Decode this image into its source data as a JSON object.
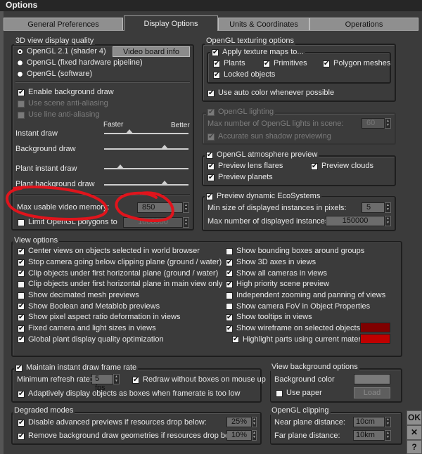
{
  "window": {
    "title": "Options"
  },
  "tabs": [
    {
      "label": "General Preferences",
      "active": false
    },
    {
      "label": "Display Options",
      "active": true
    },
    {
      "label": "Units & Coordinates",
      "active": false
    },
    {
      "label": "Operations",
      "active": false
    }
  ],
  "quality": {
    "legend": "3D view display quality",
    "renderers": [
      {
        "label": "OpenGL 2.1 (shader 4)",
        "selected": true
      },
      {
        "label": "OpenGL (fixed hardware pipeline)",
        "selected": false
      },
      {
        "label": "OpenGL (software)",
        "selected": false
      }
    ],
    "video_board_button": "Video board info",
    "enable_bg": {
      "label": "Enable background draw",
      "checked": true
    },
    "scene_aa": {
      "label": "Use scene anti-aliasing",
      "checked": false
    },
    "line_aa": {
      "label": "Use line anti-aliasing",
      "checked": false
    },
    "slider_left": "Faster",
    "slider_right": "Better",
    "sliders": [
      {
        "label": "Instant draw",
        "value": 0.3
      },
      {
        "label": "Background draw",
        "value": 0.72
      },
      {
        "label": "Plant instant draw",
        "value": 0.19
      },
      {
        "label": "Plant background draw",
        "value": 0.72
      }
    ],
    "max_mem_label": "Max usable video memory:",
    "max_mem_value": "850",
    "limit_poly": {
      "label": "Limit OpenGL polygons to",
      "checked": false
    },
    "limit_poly_value": "1000000"
  },
  "texturing": {
    "legend": "OpenGL texturing options",
    "apply": {
      "label": "Apply texture maps to...",
      "checked": true
    },
    "plants": {
      "label": "Plants",
      "checked": true
    },
    "primitives": {
      "label": "Primitives",
      "checked": true
    },
    "polygon": {
      "label": "Polygon meshes",
      "checked": true
    },
    "locked": {
      "label": "Locked objects",
      "checked": true
    },
    "auto_color": {
      "label": "Use auto color whenever possible",
      "checked": true
    }
  },
  "lighting": {
    "legend": {
      "label": "OpenGL lighting",
      "checked": true
    },
    "max_lights_label": "Max number of OpenGL lights in scene:",
    "max_lights_value": "60",
    "sun": {
      "label": "Accurate sun shadow previewing",
      "checked": true
    }
  },
  "atmosphere": {
    "legend": {
      "label": "OpenGL atmosphere preview",
      "checked": true
    },
    "lens": {
      "label": "Preview lens flares",
      "checked": true
    },
    "clouds": {
      "label": "Preview clouds",
      "checked": true
    },
    "planets": {
      "label": "Preview planets",
      "checked": true
    }
  },
  "eco": {
    "legend": {
      "label": "Preview dynamic EcoSystems",
      "checked": true
    },
    "min_size_label": "Min size of displayed instances in pixels:",
    "min_size_value": "5",
    "max_num_label": "Max number of displayed instances:",
    "max_num_value": "150000"
  },
  "view_options": {
    "legend": "View options",
    "left": [
      {
        "label": "Center views on objects selected in world browser",
        "checked": true
      },
      {
        "label": "Stop camera going below clipping plane (ground / water)",
        "checked": true
      },
      {
        "label": "Clip objects under first horizontal plane (ground / water)",
        "checked": true
      },
      {
        "label": "Clip objects under first horizontal plane in main view only",
        "checked": false
      },
      {
        "label": "Show decimated mesh previews",
        "checked": false
      },
      {
        "label": "Show Boolean and Metablob previews",
        "checked": true
      },
      {
        "label": "Show pixel aspect ratio deformation in views",
        "checked": true
      },
      {
        "label": "Fixed camera and light sizes in views",
        "checked": true
      },
      {
        "label": "Global plant display quality optimization",
        "checked": true
      }
    ],
    "right": [
      {
        "label": "Show bounding boxes around groups",
        "checked": false
      },
      {
        "label": "Show 3D axes in views",
        "checked": true
      },
      {
        "label": "Show all cameras in views",
        "checked": true
      },
      {
        "label": "High priority scene preview",
        "checked": true
      },
      {
        "label": "Independent zooming and panning of views",
        "checked": false
      },
      {
        "label": "Show camera FoV in Object Properties",
        "checked": false
      },
      {
        "label": "Show tooltips in views",
        "checked": true
      },
      {
        "label": "Show wireframe on selected objects",
        "checked": true
      },
      {
        "label": "Highlight parts using current material",
        "checked": true
      }
    ],
    "wireframe_color": "#800000",
    "highlight_color": "#c00000"
  },
  "framerate": {
    "legend": {
      "label": "Maintain instant draw frame rate",
      "checked": true
    },
    "min_refresh_label": "Minimum refresh rate:",
    "min_refresh_value": "5 fps",
    "redraw": {
      "label": "Redraw without boxes on mouse up",
      "checked": true
    },
    "adaptive": {
      "label": "Adaptively display objects as boxes when framerate is too low",
      "checked": true
    }
  },
  "background": {
    "legend": "View background options",
    "color_label": "Background color",
    "color": "#7a7a7a",
    "use_paper": {
      "label": "Use paper",
      "checked": false
    },
    "load_button": "Load"
  },
  "degraded": {
    "legend": "Degraded modes",
    "disable": {
      "label": "Disable advanced previews if resources drop below:",
      "checked": true
    },
    "disable_value": "25%",
    "remove": {
      "label": "Remove background draw geometries if resources drop below:",
      "checked": true
    },
    "remove_value": "10%"
  },
  "clipping": {
    "legend": "OpenGL clipping",
    "near_label": "Near plane distance:",
    "near_value": "10cm",
    "far_label": "Far plane distance:",
    "far_value": "10km"
  },
  "buttons": {
    "ok": "OK",
    "cancel": "✕",
    "help": "?"
  },
  "colors": {
    "annotation": "#e0141c"
  }
}
